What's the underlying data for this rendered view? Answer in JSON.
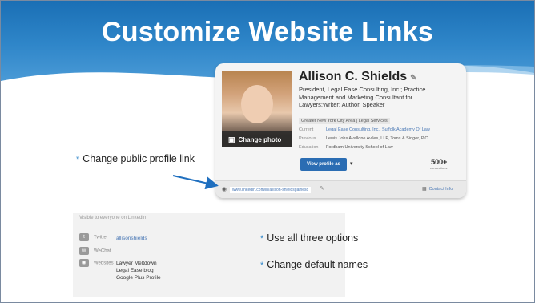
{
  "slide": {
    "title": "Customize Website Links"
  },
  "profile": {
    "name": "Allison C. Shields",
    "headline": "President, Legal Ease Consulting, Inc.; Practice Management and Marketing Consultant for Lawyers;Writer; Author, Speaker",
    "location": "Greater New York City Area | Legal Services",
    "rows": [
      {
        "label": "Current",
        "value": "Legal Ease Consulting, Inc., Suffolk Academy Of Law"
      },
      {
        "label": "Previous",
        "value": "Lewis Johs Avallone Aviles, LLP, Toms & Singer, P.C."
      },
      {
        "label": "Education",
        "value": "Fordham University School of Law"
      }
    ],
    "photo_label": "Change photo",
    "view_button": "View profile as",
    "connections": "500+",
    "connections_label": "connections",
    "public_url": "www.linkedin.com/in/allison-shieldsgalnesd",
    "contact_info": "Contact Info"
  },
  "bullets": {
    "change_link": "Change public profile link",
    "use_all": "Use all three options",
    "change_names": "Change default names"
  },
  "websites_panel": {
    "header": "Visible to everyone on LinkedIn",
    "twitter_label": "Twitter",
    "twitter_value": "allisonshields",
    "wechat_label": "WeChat",
    "websites_label": "Websites",
    "sites": [
      "Lawyer Meltdown",
      "Legal Ease blog",
      "Google Plus Profile"
    ]
  },
  "colors": {
    "banner": "#1a6fb5",
    "accent": "#2f86c9",
    "arrow": "#1f6fbf",
    "linkedin_button": "#2b6db3"
  }
}
